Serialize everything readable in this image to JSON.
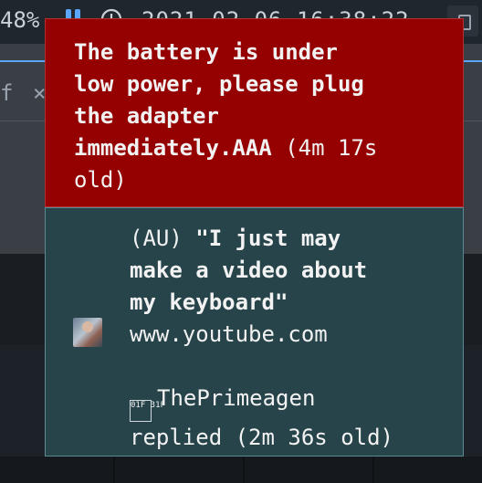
{
  "statusbar": {
    "battery_percent": "48%",
    "datetime": "2021-02-06 16:38:22",
    "accent_color": "#5aa6ff"
  },
  "browser": {
    "tab_letter": "f",
    "tab_close": "×"
  },
  "notifications": [
    {
      "type": "battery-warning",
      "background": "#950000",
      "message": "The battery is under low power, please plug the adapter immediately.AAA",
      "message_lines": [
        "The battery is under",
        "low power, please plug",
        "the adapter",
        "immediately.AAA"
      ],
      "age": "(4m 17s",
      "age_cont": "old)"
    },
    {
      "type": "youtube-reply",
      "background": "#27444b",
      "icon": "youtube-thumbnail-avatar",
      "prefix": "(AU)",
      "title_lines": [
        "\"I just may",
        "make a video about",
        "my keyboard\""
      ],
      "source": "www.youtube.com",
      "reply_icon": "unicode-1F31F-icon",
      "reply_icon_text": "01F 31F",
      "author": "ThePrimeagen",
      "action": "replied (2m 36s old)"
    }
  ]
}
